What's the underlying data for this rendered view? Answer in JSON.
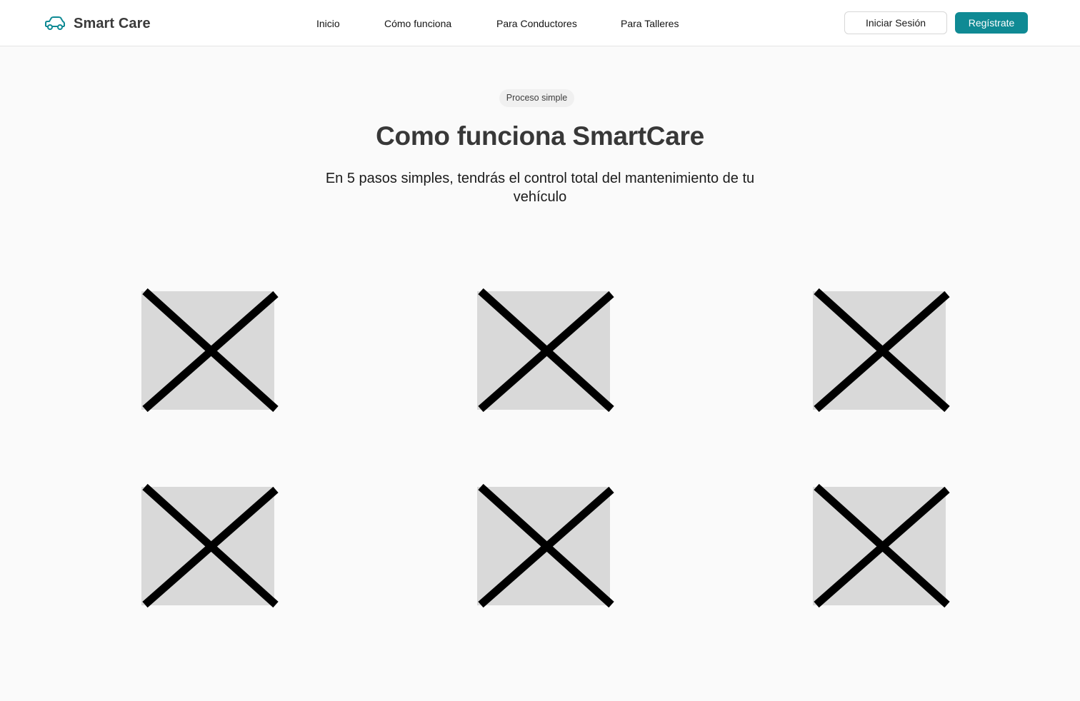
{
  "header": {
    "brand": {
      "name": "Smart Care",
      "icon": "car-icon"
    },
    "nav": [
      {
        "label": "Inicio"
      },
      {
        "label": "Cómo funciona"
      },
      {
        "label": "Para Conductores"
      },
      {
        "label": "Para Talleres"
      }
    ],
    "login_label": "Iniciar Sesión",
    "signup_label": "Regístrate"
  },
  "hero": {
    "badge": "Proceso simple",
    "title": "Como funciona SmartCare",
    "subtitle": "En 5 pasos simples, tendrás el control total del mantenimiento de tu vehículo"
  },
  "steps": [
    {
      "image": "image-placeholder-icon"
    },
    {
      "image": "image-placeholder-icon"
    },
    {
      "image": "image-placeholder-icon"
    },
    {
      "image": "image-placeholder-icon"
    },
    {
      "image": "image-placeholder-icon"
    },
    {
      "image": "image-placeholder-icon"
    }
  ],
  "colors": {
    "accent": "#0f8a94",
    "background": "#fafafa",
    "placeholder_fill": "#d9d9d9"
  }
}
